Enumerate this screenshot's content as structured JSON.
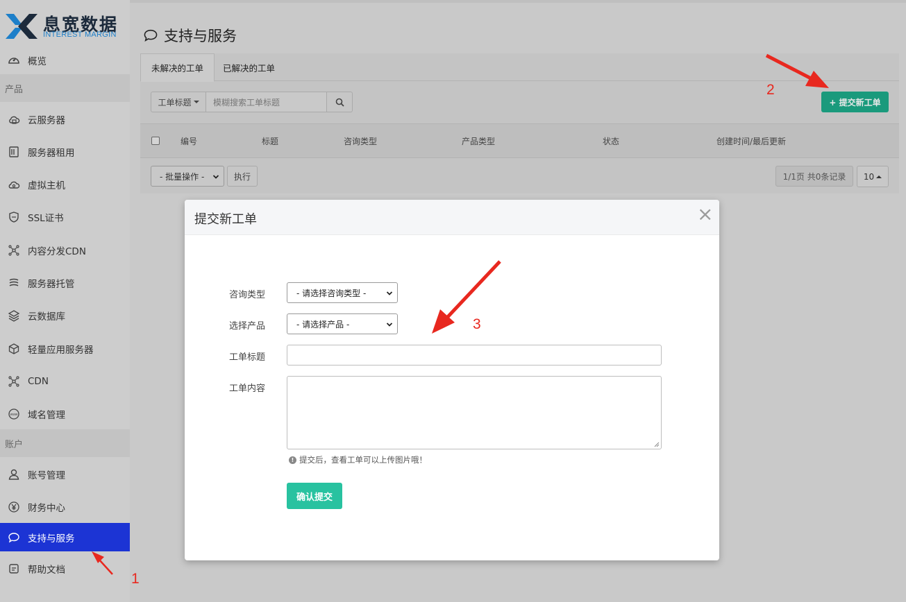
{
  "brand": {
    "name_cn": "息宽数据",
    "name_en": "INTEREST MARGIN",
    "colors": {
      "primary": "#1c2a3b",
      "accent": "#1d7fc9"
    }
  },
  "sidebar": {
    "overview": {
      "label": "概览",
      "icon": "dashboard-icon"
    },
    "group_products": "产品",
    "products": [
      {
        "label": "云服务器",
        "icon": "cloud-server-icon"
      },
      {
        "label": "服务器租用",
        "icon": "server-rack-icon"
      },
      {
        "label": "虚拟主机",
        "icon": "virtual-host-icon"
      },
      {
        "label": "SSL证书",
        "icon": "ssl-shield-icon"
      },
      {
        "label": "内容分发CDN",
        "icon": "cdn-network-icon"
      },
      {
        "label": "服务器托管",
        "icon": "hosting-icon"
      },
      {
        "label": "云数据库",
        "icon": "database-layers-icon"
      },
      {
        "label": "轻量应用服务器",
        "icon": "cube-icon"
      },
      {
        "label": "CDN",
        "icon": "cdn-icon"
      },
      {
        "label": "域名管理",
        "icon": "www-icon"
      }
    ],
    "group_account": "账户",
    "account": [
      {
        "label": "账号管理",
        "icon": "user-icon"
      },
      {
        "label": "财务中心",
        "icon": "yen-icon"
      },
      {
        "label": "支持与服务",
        "icon": "chat-bubble-icon",
        "active": true
      },
      {
        "label": "帮助文档",
        "icon": "document-icon"
      }
    ],
    "active_color": "#1c34d4"
  },
  "page": {
    "title": "支持与服务"
  },
  "tabs": [
    {
      "label": "未解决的工单",
      "active": true
    },
    {
      "label": "已解决的工单",
      "active": false
    }
  ],
  "search": {
    "field_label": "工单标题",
    "placeholder": "模糊搜索工单标题"
  },
  "new_ticket_button": "+ 提交新工单",
  "table": {
    "columns": [
      "编号",
      "标题",
      "咨询类型",
      "产品类型",
      "状态",
      "创建时间/最后更新"
    ],
    "rows": []
  },
  "bulk": {
    "select_label": "- 批量操作 -",
    "execute_label": "执行"
  },
  "pagination": {
    "info": "1/1页 共0条记录",
    "page_size": "10"
  },
  "modal": {
    "title": "提交新工单",
    "close": "×",
    "fields": {
      "type_label": "咨询类型",
      "type_value": "- 请选择咨询类型 -",
      "product_label": "选择产品",
      "product_value": "- 请选择产品 -",
      "title_label": "工单标题",
      "title_value": "",
      "content_label": "工单内容",
      "content_value": ""
    },
    "hint": "提交后，查看工单可以上传图片哦！",
    "submit": "确认提交",
    "submit_color": "#28c2a0"
  },
  "annotations": {
    "step1": "1",
    "step2": "2",
    "step3": "3",
    "color": "#e8281f"
  }
}
